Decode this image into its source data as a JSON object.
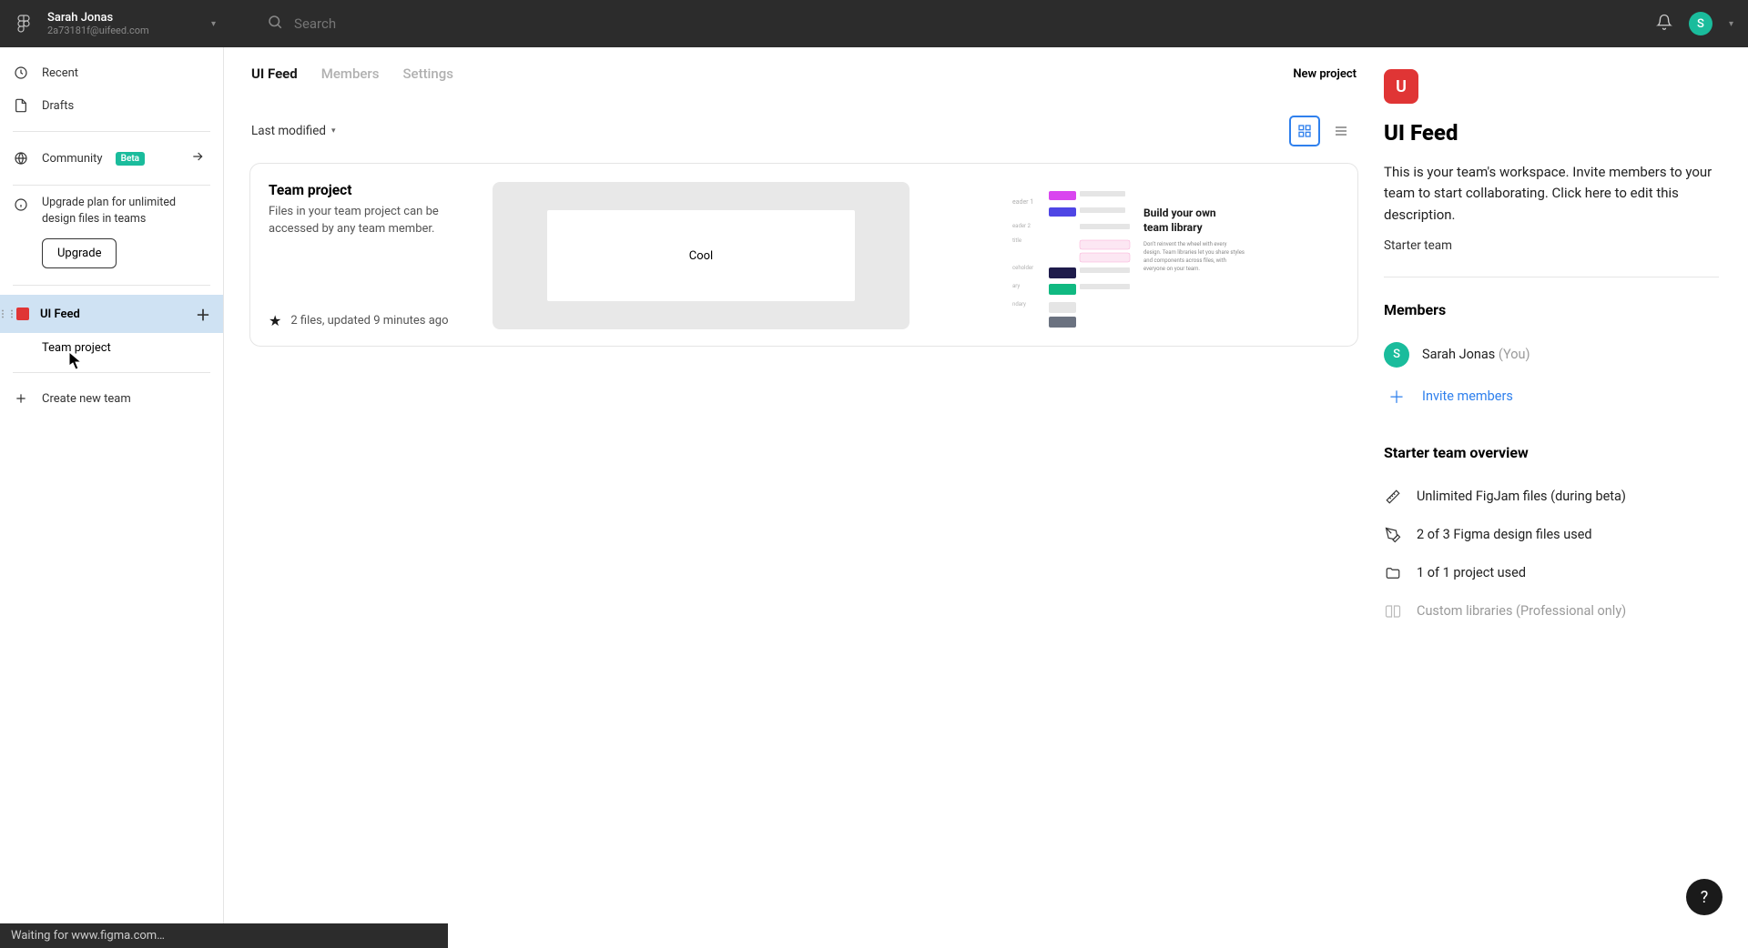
{
  "header": {
    "user_name": "Sarah Jonas",
    "user_email": "2a73181f@uifeed.com",
    "search_placeholder": "Search",
    "avatar_letter": "S"
  },
  "sidebar": {
    "recent": "Recent",
    "drafts": "Drafts",
    "community": "Community",
    "beta": "Beta",
    "upgrade_text": "Upgrade plan for unlimited design files in teams",
    "upgrade_btn": "Upgrade",
    "team_name": "UI Feed",
    "team_project": "Team project",
    "create_team": "Create new team"
  },
  "tabs": {
    "t1": "UI Feed",
    "t2": "Members",
    "t3": "Settings",
    "new_project": "New project"
  },
  "sort": {
    "label": "Last modified"
  },
  "project": {
    "title": "Team project",
    "desc": "Files in your team project can be accessed by any team member.",
    "meta": "2 files, updated 9 minutes ago",
    "thumb1_label": "Cool",
    "thumb2_title1": "Build your own",
    "thumb2_title2": "team library"
  },
  "aside": {
    "logo_letter": "U",
    "title": "UI Feed",
    "desc": "This is your team's workspace. Invite members to your team to start collaborating. Click here to edit this description.",
    "plan": "Starter team",
    "members_title": "Members",
    "member_name": "Sarah Jonas",
    "member_you": "(You)",
    "member_avatar": "S",
    "invite": "Invite members",
    "overview_title": "Starter team overview",
    "ov1": "Unlimited FigJam files (during beta)",
    "ov2": "2 of 3 Figma design files used",
    "ov3": "1 of 1 project used",
    "ov4": "Custom libraries (Professional only)"
  },
  "status": "Waiting for www.figma.com…",
  "help": "?"
}
